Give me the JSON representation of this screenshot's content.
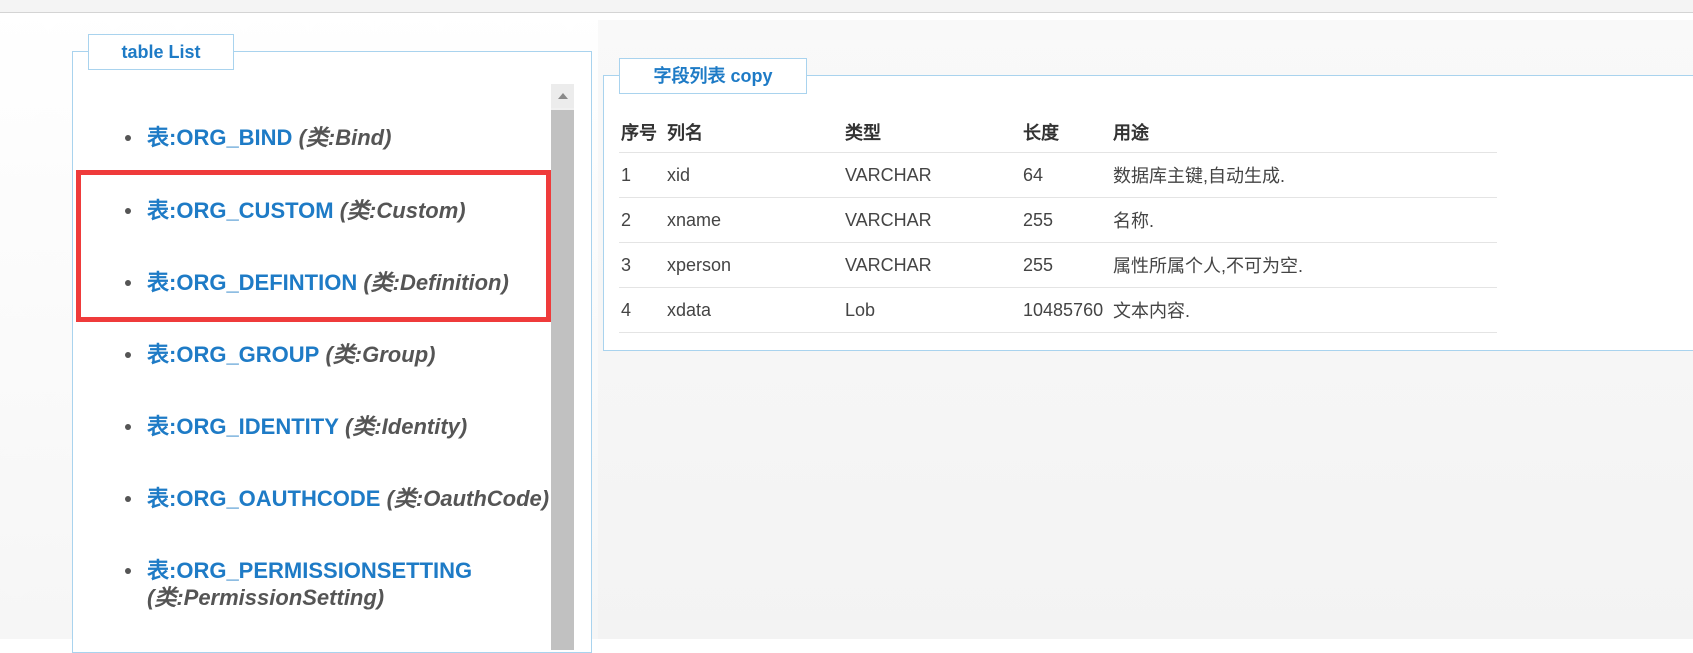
{
  "left_panel": {
    "legend": "table List",
    "items": [
      {
        "table": "表:ORG_BIND",
        "class": "(类:Bind)"
      },
      {
        "table": "表:ORG_CUSTOM",
        "class": "(类:Custom)"
      },
      {
        "table": "表:ORG_DEFINTION",
        "class": "(类:Definition)"
      },
      {
        "table": "表:ORG_GROUP",
        "class": "(类:Group)"
      },
      {
        "table": "表:ORG_IDENTITY",
        "class": "(类:Identity)"
      },
      {
        "table": "表:ORG_OAUTHCODE",
        "class": "(类:OauthCode)"
      },
      {
        "table": "表:ORG_PERMISSIONSETTING",
        "class": "(类:PermissionSetting)"
      }
    ]
  },
  "right_panel": {
    "legend": "字段列表 copy",
    "headers": [
      "序号",
      "列名",
      "类型",
      "长度",
      "用途"
    ],
    "rows": [
      [
        "1",
        "xid",
        "VARCHAR",
        "64",
        "数据库主键,自动生成."
      ],
      [
        "2",
        "xname",
        "VARCHAR",
        "255",
        "名称."
      ],
      [
        "3",
        "xperson",
        "VARCHAR",
        "255",
        "属性所属个人,不可为空."
      ],
      [
        "4",
        "xdata",
        "Lob",
        "10485760",
        "文本内容."
      ]
    ]
  },
  "colors": {
    "link": "#1e7bc6",
    "border": "#a9d3ee",
    "highlight": "#ef3b3b"
  }
}
